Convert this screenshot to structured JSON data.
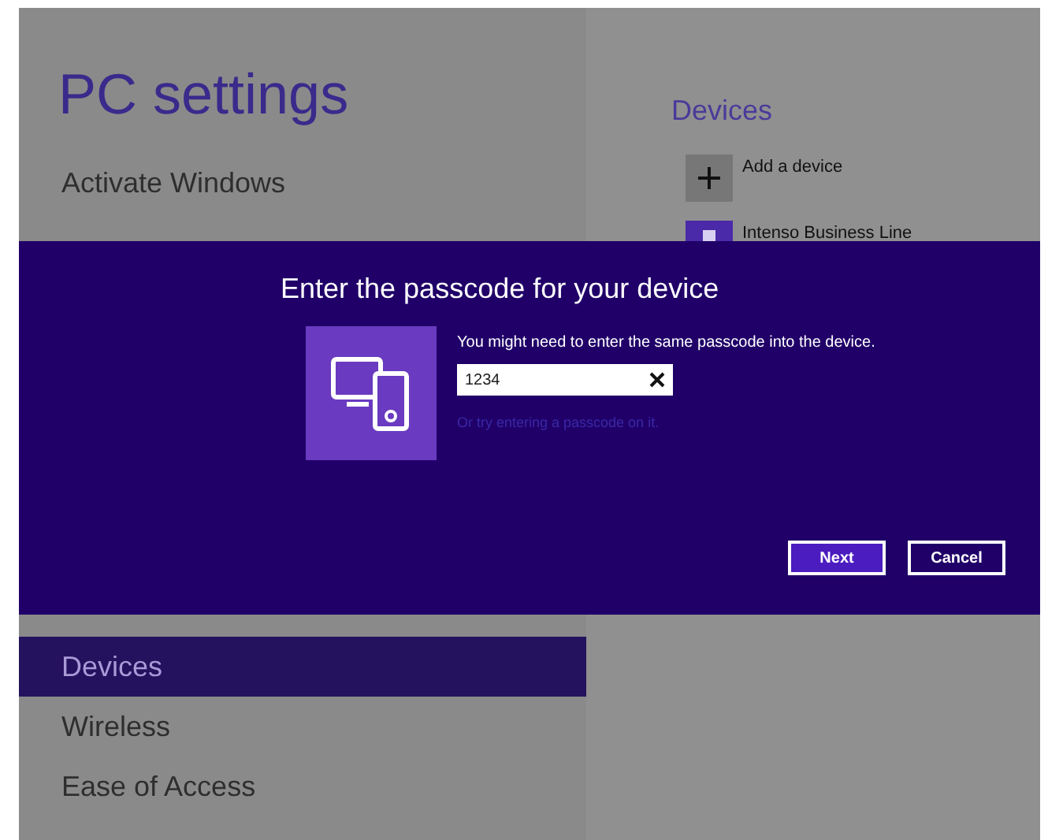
{
  "title": "PC settings",
  "nav": [
    {
      "label": "Activate Windows",
      "selected": false
    },
    {
      "kind": "gap"
    },
    {
      "label": "Devices",
      "selected": true
    },
    {
      "label": "Wireless",
      "selected": false
    },
    {
      "label": "Ease of Access",
      "selected": false
    }
  ],
  "pane": {
    "heading": "Devices",
    "items": [
      {
        "kind": "add",
        "label": "Add a device"
      },
      {
        "kind": "device",
        "label": "Intenso Business Line"
      }
    ]
  },
  "dialog": {
    "title": "Enter the passcode for your device",
    "message": "You might need to enter the same passcode into the device.",
    "input": {
      "value": "1234"
    },
    "link": "Or try entering a passcode on it.",
    "buttons": [
      {
        "label": "Next",
        "kind": "primary"
      },
      {
        "label": "Cancel",
        "kind": "secondary"
      }
    ]
  }
}
